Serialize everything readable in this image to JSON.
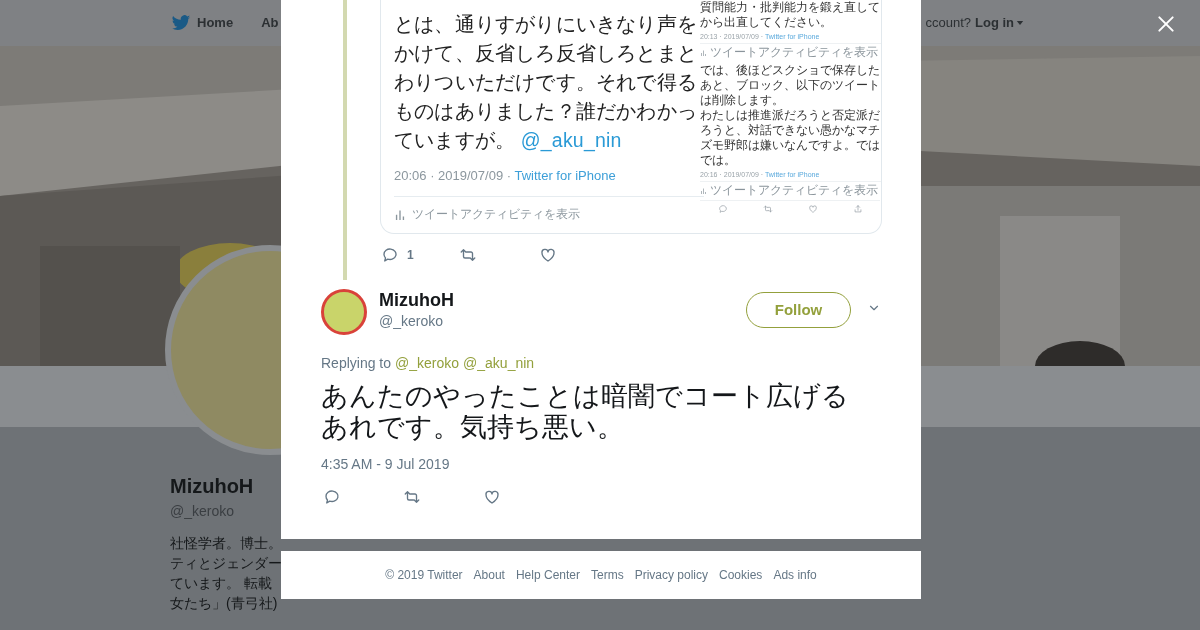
{
  "nav": {
    "items": [
      {
        "label": "Home"
      },
      {
        "label": "Ab"
      }
    ],
    "account_prompt": "ccount?",
    "login": "Log in"
  },
  "profile": {
    "name": "MizuhoH",
    "handle": "@_keroko",
    "bio_lines": [
      "社怪学者。博士。",
      "ティとジェンダー",
      "ています。 転載",
      "女たち」(青弓社)"
    ]
  },
  "modal": {
    "thread_image": {
      "left": {
        "text": "とは、通りすがりにいきなり声をかけて、反省しろ反省しろとまとわりついただけです。それで得るものはありました？誰だかわかっていますが。",
        "mention": "@_aku_nin",
        "meta": "20:06 · 2019/07/09 · ",
        "source": "Twitter for iPhone",
        "activity": "ツイートアクティビティを表示"
      },
      "right": {
        "blocks": [
          {
            "paragraphs": [
              "質問能力・批判能力を鍛え直してから出直してください。"
            ],
            "meta": "20:13 · 2019/07/09 · ",
            "source": "Twitter for iPhone",
            "activity": "ツイートアクティビティを表示"
          },
          {
            "paragraphs": [
              "では、後ほどスクショで保存したあと、ブロック、以下のツイートは削除します。",
              "わたしは推進派だろうと否定派だろうと、対話できない愚かなマチズモ野郎は嫌いなんですよ。ではでは。"
            ],
            "meta": "20:16 · 2019/07/09 · ",
            "source": "Twitter for iPhone",
            "activity": "ツイートアクティビティを表示"
          }
        ]
      }
    },
    "parent_actions": {
      "reply_count": "1"
    },
    "tweet": {
      "name": "MizuhoH",
      "handle": "@_keroko",
      "follow": "Follow",
      "replying_label": "Replying to",
      "reply_to": [
        "@_keroko",
        "@_aku_nin"
      ],
      "text": "あんたのやったことは暗闇でコート広げるあれです。気持ち悪い。",
      "time": "4:35 AM - 9 Jul 2019"
    }
  },
  "footer": {
    "links": [
      "© 2019 Twitter",
      "About",
      "Help Center",
      "Terms",
      "Privacy policy",
      "Cookies",
      "Ads info"
    ]
  }
}
